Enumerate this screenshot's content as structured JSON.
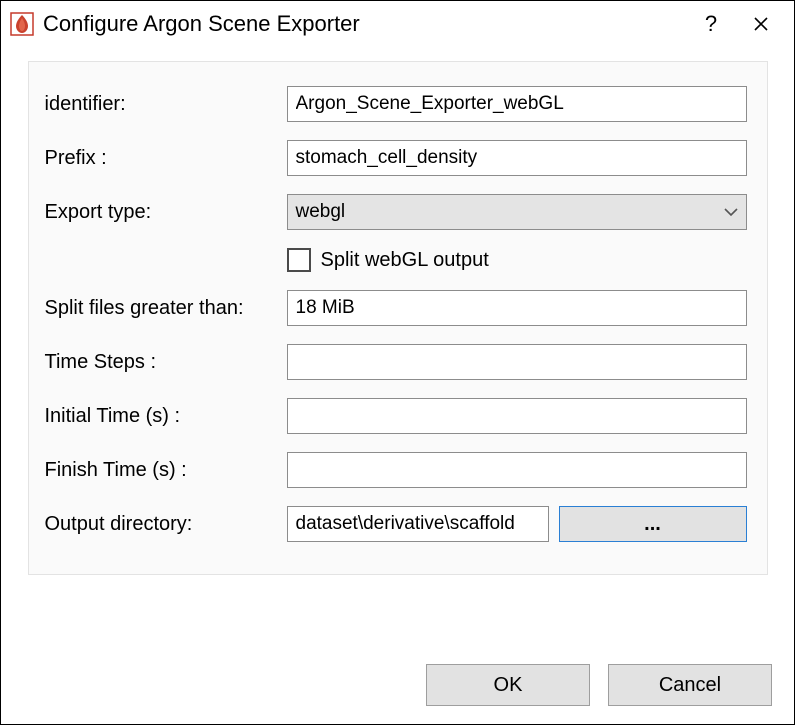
{
  "window": {
    "title": "Configure Argon Scene Exporter"
  },
  "form": {
    "identifier": {
      "label": "identifier:",
      "value": "Argon_Scene_Exporter_webGL"
    },
    "prefix": {
      "label": "Prefix :",
      "value": "stomach_cell_density"
    },
    "export_type": {
      "label": "Export type:",
      "value": "webgl"
    },
    "split_output": {
      "label": "Split webGL output",
      "checked": false
    },
    "split_threshold": {
      "label": "Split files greater than:",
      "value": "18 MiB"
    },
    "time_steps": {
      "label": "Time Steps :",
      "value": ""
    },
    "initial_time": {
      "label": "Initial Time (s) :",
      "value": ""
    },
    "finish_time": {
      "label": "Finish Time (s) :",
      "value": ""
    },
    "output_directory": {
      "label": "Output directory:",
      "value": "dataset\\derivative\\scaffold",
      "browse_label": "..."
    }
  },
  "buttons": {
    "ok": "OK",
    "cancel": "Cancel"
  }
}
